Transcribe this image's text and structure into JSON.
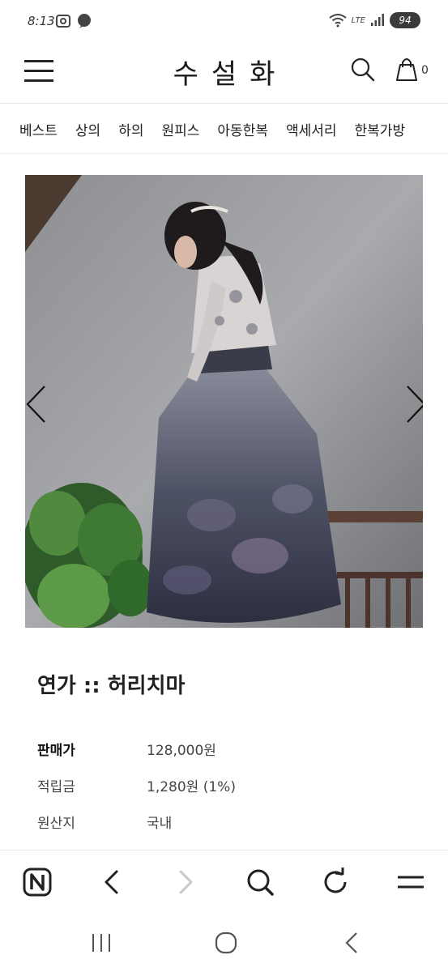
{
  "status_bar": {
    "time": "8:13",
    "network": "LTE",
    "battery": "94",
    "icons": [
      "gallery-icon",
      "chat-icon",
      "wifi-icon",
      "signal-icon",
      "battery-icon"
    ]
  },
  "header": {
    "logo": "수설화",
    "cart_count": "0",
    "icons": [
      "menu-icon",
      "search-icon",
      "cart-icon"
    ]
  },
  "categories": [
    "베스트",
    "상의",
    "하의",
    "원피스",
    "아동한복",
    "액세서리",
    "한복가방"
  ],
  "product": {
    "name": "연가 :: 허리치마",
    "info": [
      {
        "label": "판매가",
        "value": "128,000원"
      },
      {
        "label": "적립금",
        "value": "1,280원 (1%)"
      },
      {
        "label": "원산지",
        "value": "국내"
      }
    ],
    "image_icons": [
      "chevron-left-icon",
      "chevron-right-icon"
    ]
  },
  "browser_bar": {
    "icons": [
      "naver-icon",
      "back-icon",
      "forward-icon",
      "search-icon",
      "refresh-icon",
      "menu-icon"
    ]
  },
  "system_nav": {
    "icons": [
      "recents-icon",
      "home-icon",
      "back-icon"
    ]
  },
  "colors": {
    "text": "#222222",
    "divider": "#e6e6e6",
    "disabled": "#c8c8c8"
  }
}
